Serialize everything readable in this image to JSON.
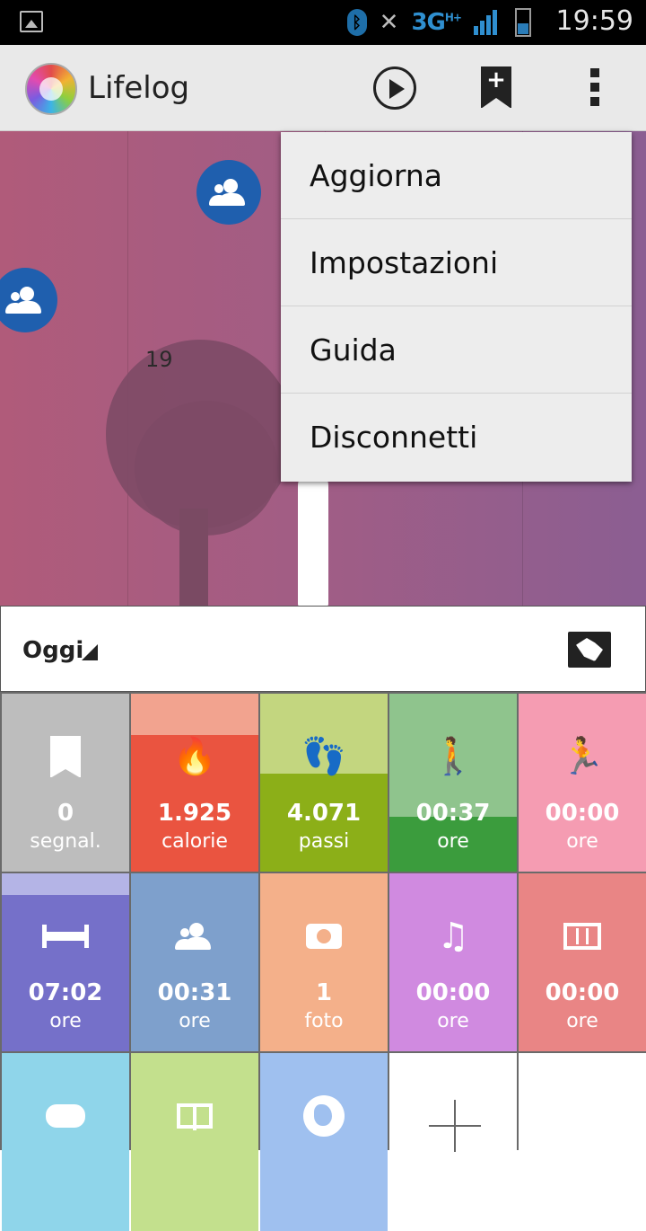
{
  "status_bar": {
    "network": "3G",
    "network_sup": "H+",
    "time": "19:59"
  },
  "action_bar": {
    "title": "Lifelog",
    "icons": [
      "app-logo-icon",
      "play-icon",
      "add-bookmark-icon",
      "overflow-menu-icon"
    ]
  },
  "timeline": {
    "hour_label": "19"
  },
  "menu": {
    "items": [
      "Aggiorna",
      "Impostazioni",
      "Guida",
      "Disconnetti"
    ]
  },
  "date_bar": {
    "label": "Oggi"
  },
  "tiles": [
    {
      "value": "0",
      "unit": "segnal.",
      "icon": "bookmark-heart-icon",
      "color": "#bdbdbd",
      "level": 0
    },
    {
      "value": "1.925",
      "unit": "calorie",
      "icon": "flame-icon",
      "color": "#f2a38f",
      "fill_color": "#ea5440",
      "level": 0.77
    },
    {
      "value": "4.071",
      "unit": "passi",
      "icon": "footsteps-icon",
      "color": "#c3d67f",
      "fill_color": "#8caf18",
      "level": 0.55
    },
    {
      "value": "00:37",
      "unit": "ore",
      "icon": "walking-icon",
      "color": "#8fc48d",
      "fill_color": "#3b9c3d",
      "level": 0.31
    },
    {
      "value": "00:00",
      "unit": "ore",
      "icon": "running-icon",
      "color": "#f59cb2",
      "level": 0
    },
    {
      "value": "07:02",
      "unit": "ore",
      "icon": "bed-icon",
      "color": "#b4b4e6",
      "fill_color": "#7570c9",
      "level": 0.88
    },
    {
      "value": "00:31",
      "unit": "ore",
      "icon": "people-icon",
      "color": "#7ea0cc",
      "level": 0
    },
    {
      "value": "1",
      "unit": "foto",
      "icon": "camera-icon",
      "color": "#f4b08a",
      "level": 0
    },
    {
      "value": "00:00",
      "unit": "ore",
      "icon": "music-icon",
      "color": "#d08ae0",
      "level": 0
    },
    {
      "value": "00:00",
      "unit": "ore",
      "icon": "film-icon",
      "color": "#e98585",
      "level": 0
    },
    {
      "value": "",
      "unit": "",
      "icon": "gamepad-icon",
      "color": "#8fd5ea",
      "level": 0
    },
    {
      "value": "",
      "unit": "",
      "icon": "book-icon",
      "color": "#c3e08d",
      "level": 0
    },
    {
      "value": "",
      "unit": "",
      "icon": "globe-icon",
      "color": "#9fc0ef",
      "level": 0
    },
    {
      "value": "",
      "unit": "",
      "icon": "add-icon",
      "color": "#ffffff",
      "level": 0
    },
    {
      "value": "",
      "unit": "",
      "icon": "",
      "color": "#ffffff",
      "level": 0
    }
  ]
}
